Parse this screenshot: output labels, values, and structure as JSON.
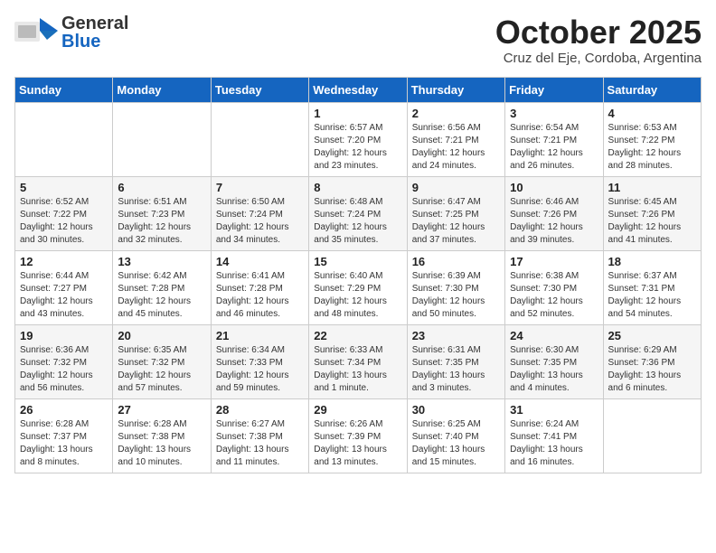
{
  "header": {
    "logo_general": "General",
    "logo_blue": "Blue",
    "month": "October 2025",
    "location": "Cruz del Eje, Cordoba, Argentina"
  },
  "columns": [
    "Sunday",
    "Monday",
    "Tuesday",
    "Wednesday",
    "Thursday",
    "Friday",
    "Saturday"
  ],
  "weeks": [
    [
      {
        "day": "",
        "info": ""
      },
      {
        "day": "",
        "info": ""
      },
      {
        "day": "",
        "info": ""
      },
      {
        "day": "1",
        "info": "Sunrise: 6:57 AM\nSunset: 7:20 PM\nDaylight: 12 hours and 23 minutes."
      },
      {
        "day": "2",
        "info": "Sunrise: 6:56 AM\nSunset: 7:21 PM\nDaylight: 12 hours and 24 minutes."
      },
      {
        "day": "3",
        "info": "Sunrise: 6:54 AM\nSunset: 7:21 PM\nDaylight: 12 hours and 26 minutes."
      },
      {
        "day": "4",
        "info": "Sunrise: 6:53 AM\nSunset: 7:22 PM\nDaylight: 12 hours and 28 minutes."
      }
    ],
    [
      {
        "day": "5",
        "info": "Sunrise: 6:52 AM\nSunset: 7:22 PM\nDaylight: 12 hours and 30 minutes."
      },
      {
        "day": "6",
        "info": "Sunrise: 6:51 AM\nSunset: 7:23 PM\nDaylight: 12 hours and 32 minutes."
      },
      {
        "day": "7",
        "info": "Sunrise: 6:50 AM\nSunset: 7:24 PM\nDaylight: 12 hours and 34 minutes."
      },
      {
        "day": "8",
        "info": "Sunrise: 6:48 AM\nSunset: 7:24 PM\nDaylight: 12 hours and 35 minutes."
      },
      {
        "day": "9",
        "info": "Sunrise: 6:47 AM\nSunset: 7:25 PM\nDaylight: 12 hours and 37 minutes."
      },
      {
        "day": "10",
        "info": "Sunrise: 6:46 AM\nSunset: 7:26 PM\nDaylight: 12 hours and 39 minutes."
      },
      {
        "day": "11",
        "info": "Sunrise: 6:45 AM\nSunset: 7:26 PM\nDaylight: 12 hours and 41 minutes."
      }
    ],
    [
      {
        "day": "12",
        "info": "Sunrise: 6:44 AM\nSunset: 7:27 PM\nDaylight: 12 hours and 43 minutes."
      },
      {
        "day": "13",
        "info": "Sunrise: 6:42 AM\nSunset: 7:28 PM\nDaylight: 12 hours and 45 minutes."
      },
      {
        "day": "14",
        "info": "Sunrise: 6:41 AM\nSunset: 7:28 PM\nDaylight: 12 hours and 46 minutes."
      },
      {
        "day": "15",
        "info": "Sunrise: 6:40 AM\nSunset: 7:29 PM\nDaylight: 12 hours and 48 minutes."
      },
      {
        "day": "16",
        "info": "Sunrise: 6:39 AM\nSunset: 7:30 PM\nDaylight: 12 hours and 50 minutes."
      },
      {
        "day": "17",
        "info": "Sunrise: 6:38 AM\nSunset: 7:30 PM\nDaylight: 12 hours and 52 minutes."
      },
      {
        "day": "18",
        "info": "Sunrise: 6:37 AM\nSunset: 7:31 PM\nDaylight: 12 hours and 54 minutes."
      }
    ],
    [
      {
        "day": "19",
        "info": "Sunrise: 6:36 AM\nSunset: 7:32 PM\nDaylight: 12 hours and 56 minutes."
      },
      {
        "day": "20",
        "info": "Sunrise: 6:35 AM\nSunset: 7:32 PM\nDaylight: 12 hours and 57 minutes."
      },
      {
        "day": "21",
        "info": "Sunrise: 6:34 AM\nSunset: 7:33 PM\nDaylight: 12 hours and 59 minutes."
      },
      {
        "day": "22",
        "info": "Sunrise: 6:33 AM\nSunset: 7:34 PM\nDaylight: 13 hours and 1 minute."
      },
      {
        "day": "23",
        "info": "Sunrise: 6:31 AM\nSunset: 7:35 PM\nDaylight: 13 hours and 3 minutes."
      },
      {
        "day": "24",
        "info": "Sunrise: 6:30 AM\nSunset: 7:35 PM\nDaylight: 13 hours and 4 minutes."
      },
      {
        "day": "25",
        "info": "Sunrise: 6:29 AM\nSunset: 7:36 PM\nDaylight: 13 hours and 6 minutes."
      }
    ],
    [
      {
        "day": "26",
        "info": "Sunrise: 6:28 AM\nSunset: 7:37 PM\nDaylight: 13 hours and 8 minutes."
      },
      {
        "day": "27",
        "info": "Sunrise: 6:28 AM\nSunset: 7:38 PM\nDaylight: 13 hours and 10 minutes."
      },
      {
        "day": "28",
        "info": "Sunrise: 6:27 AM\nSunset: 7:38 PM\nDaylight: 13 hours and 11 minutes."
      },
      {
        "day": "29",
        "info": "Sunrise: 6:26 AM\nSunset: 7:39 PM\nDaylight: 13 hours and 13 minutes."
      },
      {
        "day": "30",
        "info": "Sunrise: 6:25 AM\nSunset: 7:40 PM\nDaylight: 13 hours and 15 minutes."
      },
      {
        "day": "31",
        "info": "Sunrise: 6:24 AM\nSunset: 7:41 PM\nDaylight: 13 hours and 16 minutes."
      },
      {
        "day": "",
        "info": ""
      }
    ]
  ]
}
